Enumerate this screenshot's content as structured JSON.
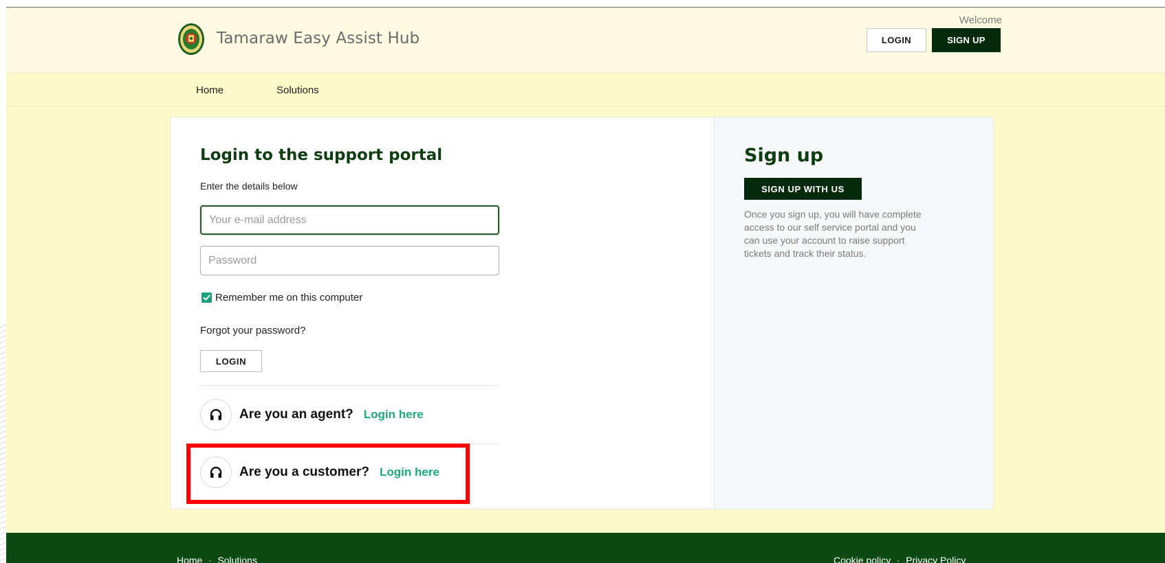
{
  "header": {
    "brand": "Tamaraw Easy Assist Hub",
    "welcome": "Welcome",
    "login_label": "LOGIN",
    "signup_label": "SIGN UP"
  },
  "nav": {
    "items": [
      {
        "label": "Home"
      },
      {
        "label": "Solutions"
      }
    ]
  },
  "login": {
    "title": "Login to the support portal",
    "subtitle": "Enter the details below",
    "email_placeholder": "Your e-mail address",
    "password_placeholder": "Password",
    "remember_label": "Remember me on this computer",
    "remember_checked": true,
    "forgot_label": "Forgot your password?",
    "login_button": "LOGIN",
    "agent_question": "Are you an agent?",
    "agent_link": "Login here",
    "customer_question": "Are you a customer?",
    "customer_link": "Login here"
  },
  "signup": {
    "title": "Sign up",
    "button": "SIGN UP WITH US",
    "description": "Once you sign up, you will have complete access to our self service portal and you can use your account to raise support tickets and track their status."
  },
  "footer": {
    "left_links": [
      "Home",
      "Solutions"
    ],
    "right_links": [
      "Cookie policy",
      "Privacy Policy"
    ]
  },
  "colors": {
    "page_bg": "#fdfac9",
    "header_bg": "#fefbe3",
    "dark_green": "#062a0e",
    "title_green": "#0f3d12",
    "link_green": "#1da77c",
    "footer_bg": "#0b4a12",
    "highlight": "#ff0000"
  },
  "icons": {
    "logo": "seal-logo-icon",
    "role": "headset-icon",
    "check": "checkmark-icon"
  }
}
